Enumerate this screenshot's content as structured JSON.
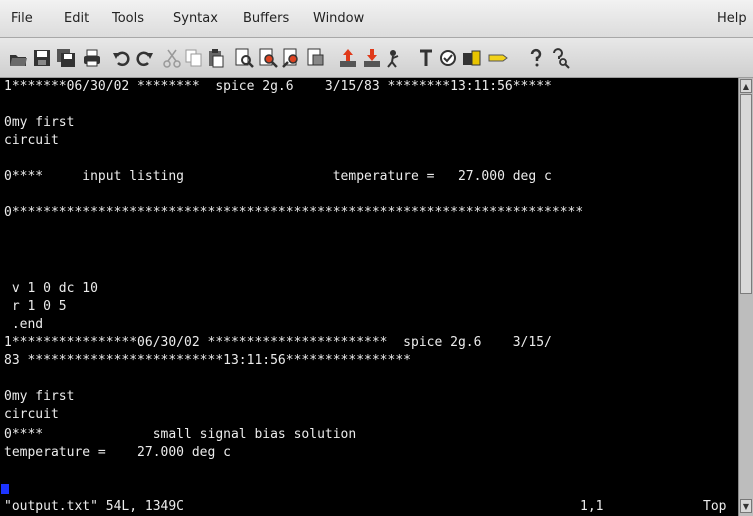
{
  "menubar": {
    "items": [
      "File",
      "Edit",
      "Tools",
      "Syntax",
      "Buffers",
      "Window"
    ],
    "help": "Help"
  },
  "toolbar": {
    "icons": [
      "open-icon",
      "save-icon",
      "save-all-icon",
      "print-icon",
      "undo-icon",
      "redo-icon",
      "cut-icon",
      "copy-icon",
      "paste-icon",
      "find-icon",
      "find-next-icon",
      "find-prev-icon",
      "load-session-icon",
      "save-session-icon",
      "run-script-icon",
      "make-icon",
      "spell-check-icon",
      "tags-icon",
      "jump-tag-icon",
      "ctags-icon",
      "help-icon",
      "find-help-icon"
    ]
  },
  "editor": {
    "lines": [
      "1*******06/30/02 ********  spice 2g.6    3/15/83 ********13:11:56*****",
      "",
      "0my first",
      "circuit",
      "",
      "0****     input listing                   temperature =   27.000 deg c",
      "",
      "0*************************************************************************",
      "",
      "",
      "",
      "",
      " v 1 0 dc 10",
      " r 1 0 5",
      " .end",
      "1****************06/30/02 ***********************  spice 2g.6    3/15/",
      "83 *************************13:11:56****************",
      "",
      "0my first",
      "circuit",
      "0****              small signal bias solution",
      "temperature =    27.000 deg c"
    ]
  },
  "status": {
    "file": "\"output.txt\" 54L, 1349C",
    "position": "1,1",
    "scroll": "Top"
  }
}
